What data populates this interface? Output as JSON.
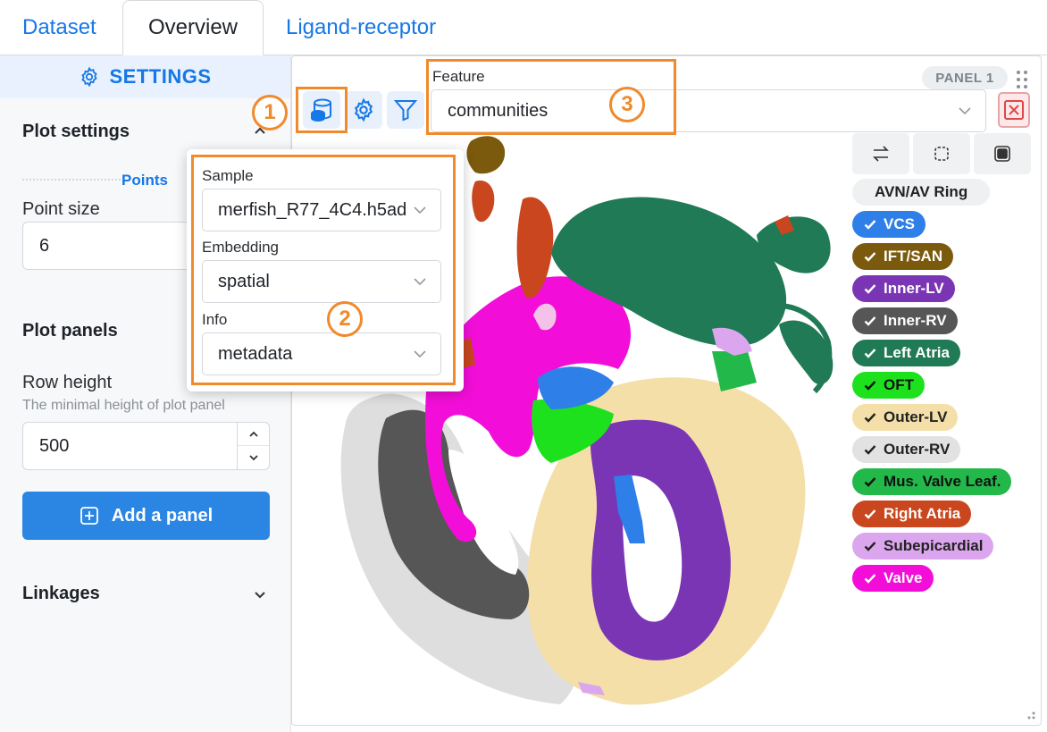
{
  "tabs": [
    {
      "label": "Dataset",
      "active": false
    },
    {
      "label": "Overview",
      "active": true
    },
    {
      "label": "Ligand-receptor",
      "active": false
    }
  ],
  "sidebar": {
    "title": "SETTINGS",
    "plot_settings": {
      "title": "Plot settings",
      "points_label": "Points",
      "point_size_label": "Point size",
      "point_size_value": "6"
    },
    "plot_panels": {
      "title": "Plot panels",
      "row_height_label": "Row height",
      "row_height_help": "The minimal height of plot panel",
      "row_height_value": "500",
      "add_button": "Add a panel"
    },
    "linkages": {
      "title": "Linkages"
    }
  },
  "panel": {
    "badge": "PANEL 1",
    "feature_label": "Feature",
    "feature_value": "communities",
    "legend_header": "AVN/AV Ring",
    "legend": [
      {
        "label": "VCS",
        "color": "#2f7fe8",
        "text": "#ffffff"
      },
      {
        "label": "IFT/SAN",
        "color": "#7b5a0e",
        "text": "#ffffff"
      },
      {
        "label": "Inner-LV",
        "color": "#7a35b5",
        "text": "#ffffff"
      },
      {
        "label": "Inner-RV",
        "color": "#565656",
        "text": "#ffffff"
      },
      {
        "label": "Left Atria",
        "color": "#1f7a55",
        "text": "#ffffff"
      },
      {
        "label": "OFT",
        "color": "#1ee11e",
        "text": "#111111"
      },
      {
        "label": "Outer-LV",
        "color": "#f4dfa8",
        "text": "#222222"
      },
      {
        "label": "Outer-RV",
        "color": "#e2e2e2",
        "text": "#222222"
      },
      {
        "label": "Mus. Valve Leaf.",
        "color": "#22b84a",
        "text": "#111111"
      },
      {
        "label": "Right Atria",
        "color": "#c9461e",
        "text": "#ffffff"
      },
      {
        "label": "Subepicardial",
        "color": "#dba6ee",
        "text": "#222222"
      },
      {
        "label": "Valve",
        "color": "#f20ed8",
        "text": "#ffffff"
      }
    ]
  },
  "popover": {
    "sample_label": "Sample",
    "sample_value": "merfish_R77_4C4.h5ad",
    "embedding_label": "Embedding",
    "embedding_value": "spatial",
    "info_label": "Info",
    "info_value": "metadata"
  },
  "annotations": {
    "one": "1",
    "two": "2",
    "three": "3",
    "color": "#f08a2c"
  },
  "icons": [
    "gear-icon",
    "database-icon",
    "filter-icon",
    "swap-icon",
    "lasso-icon",
    "rect-select-icon",
    "close-icon",
    "chevron-down-icon",
    "plus-square-icon",
    "drag-handle-icon",
    "resize-icon",
    "check-icon"
  ]
}
